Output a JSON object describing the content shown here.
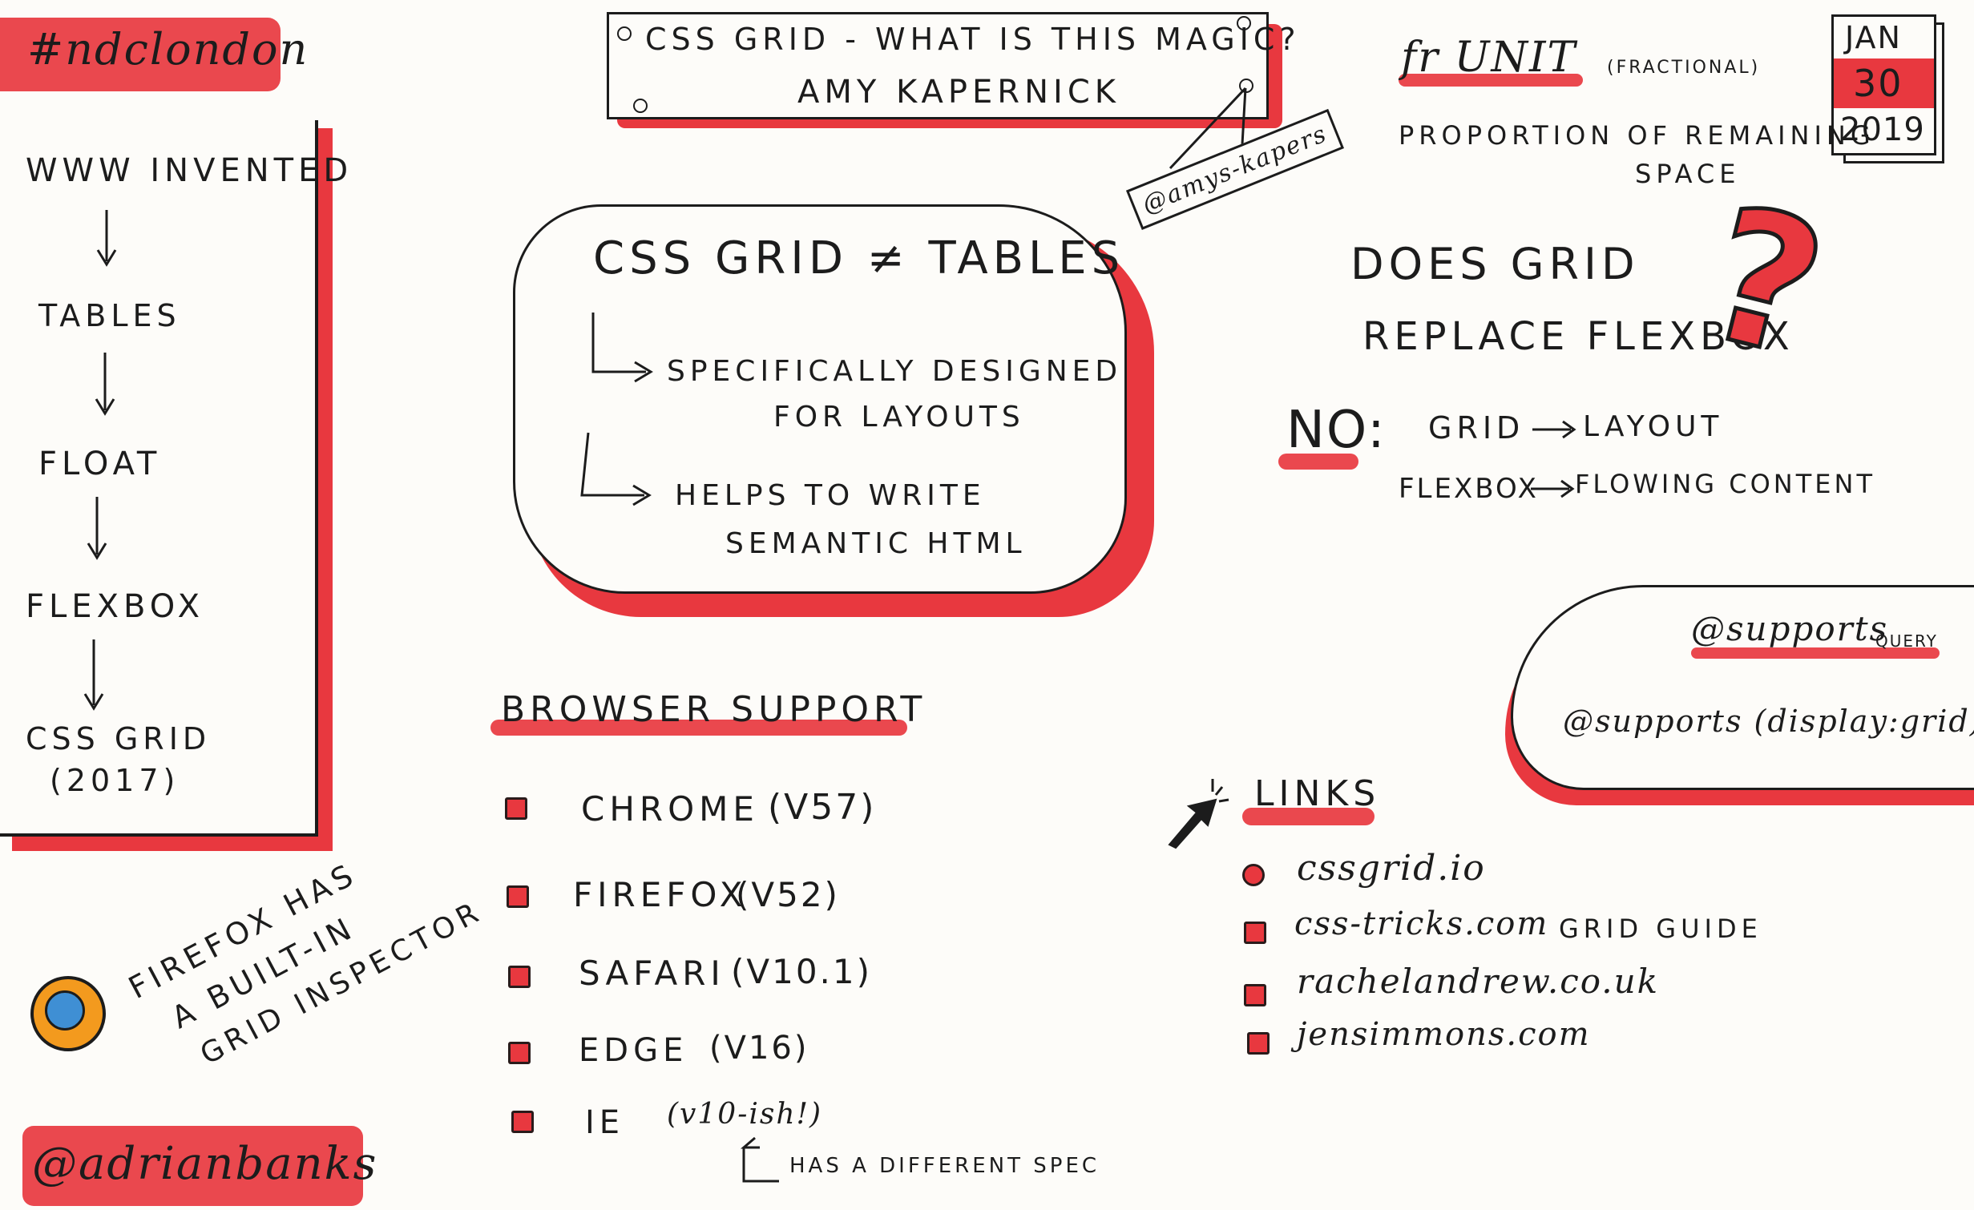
{
  "event": {
    "hashtag": "#ndclondon",
    "author_handle": "@adrianbanks"
  },
  "calendar": {
    "month": "JAN",
    "day": "30",
    "year": "2019"
  },
  "talk": {
    "title": "CSS GRID - WHAT IS THIS MAGIC?",
    "speaker": "AMY KAPERNICK",
    "speaker_handle": "@amys-kapers"
  },
  "history": {
    "steps": [
      "WWW INVENTED",
      "TABLES",
      "FLOAT",
      "FLEXBOX",
      "CSS GRID"
    ],
    "grid_year": "(2017)"
  },
  "firefox_note": {
    "lines": [
      "FIREFOX HAS",
      "A BUILT-IN",
      "GRID INSPECTOR"
    ]
  },
  "grid_vs_tables": {
    "heading": "CSS GRID ≠ TABLES",
    "point1": [
      "SPECIFICALLY DESIGNED",
      "FOR LAYOUTS"
    ],
    "point2": [
      "HELPS TO WRITE",
      "SEMANTIC HTML"
    ]
  },
  "fr_unit": {
    "title": "fr UNIT",
    "subtitle": "(FRACTIONAL)",
    "desc": [
      "PROPORTION OF REMAINING",
      "SPACE"
    ]
  },
  "flexbox_question": {
    "question": [
      "DOES GRID",
      "REPLACE FLEXBOX"
    ],
    "answer": "NO:",
    "grid": "GRID",
    "grid_use": "LAYOUT",
    "flexbox": "FLEXBOX",
    "flexbox_use": "FLOWING CONTENT"
  },
  "supports": {
    "title": "@supports",
    "query": "QUERY",
    "example": "@supports (display:grid)"
  },
  "browser_support": {
    "title": "BROWSER SUPPORT",
    "items": [
      {
        "name": "CHROME",
        "version": "(v57)"
      },
      {
        "name": "FIREFOX",
        "version": "(v52)"
      },
      {
        "name": "SAFARI",
        "version": "(v10.1)"
      },
      {
        "name": "EDGE",
        "version": "(v16)"
      },
      {
        "name": "IE",
        "version": "(v10-ish!)"
      }
    ],
    "ie_note": "HAS A DIFFERENT SPEC"
  },
  "links": {
    "title": "LINKS",
    "items": [
      "cssgrid.io",
      "css-tricks.com",
      "rachelandrew.co.uk",
      "jensimmons.com"
    ],
    "css_tricks_suffix": "GRID GUIDE"
  },
  "colors": {
    "accent": "#e8383f",
    "ink": "#1c1c1c",
    "paper": "#fdfcf9"
  }
}
